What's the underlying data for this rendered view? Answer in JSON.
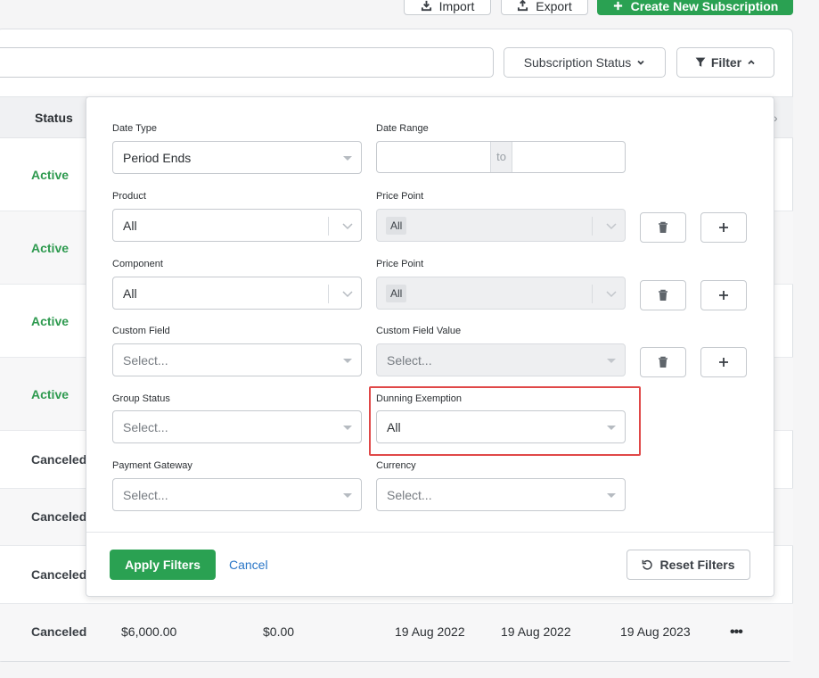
{
  "toolbar": {
    "import_label": "Import",
    "export_label": "Export",
    "create_label": "Create New Subscription"
  },
  "controls": {
    "search_value": "",
    "subscription_status_label": "Subscription Status",
    "filter_label": "Filter"
  },
  "table": {
    "status_header": "Status",
    "rows": [
      {
        "status": "Active"
      },
      {
        "status": "Active"
      },
      {
        "status": "Active"
      },
      {
        "status": "Active"
      },
      {
        "status": "Canceled"
      },
      {
        "status": "Canceled"
      },
      {
        "status": "Canceled"
      },
      {
        "status": "Canceled",
        "amount": "$6,000.00",
        "balance": "$0.00",
        "created": "19 Aug 2022",
        "started": "19 Aug 2022",
        "ends": "19 Aug 2023"
      }
    ]
  },
  "filters": {
    "date_type": {
      "label": "Date Type",
      "value": "Period Ends"
    },
    "date_range": {
      "label": "Date Range",
      "from": "",
      "separator": "to",
      "to": ""
    },
    "product": {
      "label": "Product",
      "value": "All"
    },
    "product_price_point": {
      "label": "Price Point",
      "value": "All"
    },
    "component": {
      "label": "Component",
      "value": "All"
    },
    "component_price_point": {
      "label": "Price Point",
      "value": "All"
    },
    "custom_field": {
      "label": "Custom Field",
      "placeholder": "Select..."
    },
    "custom_field_value": {
      "label": "Custom Field Value",
      "placeholder": "Select..."
    },
    "group_status": {
      "label": "Group Status",
      "placeholder": "Select..."
    },
    "dunning_exemption": {
      "label": "Dunning Exemption",
      "value": "All"
    },
    "payment_gateway": {
      "label": "Payment Gateway",
      "placeholder": "Select..."
    },
    "currency": {
      "label": "Currency",
      "placeholder": "Select..."
    },
    "apply_label": "Apply Filters",
    "cancel_label": "Cancel",
    "reset_label": "Reset Filters"
  },
  "colors": {
    "accent_green": "#2aa152",
    "active_status": "#2e9a4f",
    "link_blue": "#2a76c7",
    "highlight_red": "#e04848"
  },
  "icons": [
    "import-icon",
    "export-icon",
    "plus-icon",
    "chevron-down-icon",
    "filter-icon",
    "chevron-up-icon",
    "trash-icon",
    "reset-icon",
    "more-icon"
  ]
}
